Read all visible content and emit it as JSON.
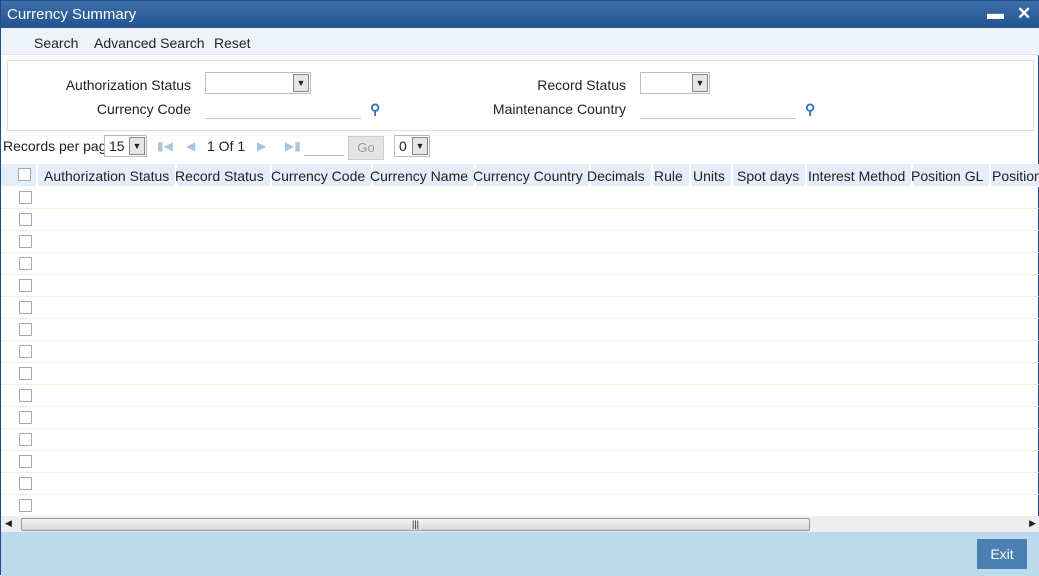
{
  "window": {
    "title": "Currency Summary",
    "minimize": "▬",
    "close": "✕"
  },
  "toolbar": {
    "search": "Search",
    "advanced_search": "Advanced Search",
    "reset": "Reset"
  },
  "filters": {
    "authorization_status": {
      "label": "Authorization Status",
      "value": ""
    },
    "record_status": {
      "label": "Record Status",
      "value": ""
    },
    "currency_code": {
      "label": "Currency Code",
      "value": ""
    },
    "maintenance_country": {
      "label": "Maintenance Country",
      "value": ""
    }
  },
  "pager": {
    "records_per_page_label": "Records per page",
    "records_per_page": "15",
    "page_text": "1 Of 1",
    "go": "Go",
    "goto_page": "0"
  },
  "table": {
    "columns": [
      "Authorization Status",
      "Record Status",
      "Currency Code",
      "Currency Name",
      "Currency Country",
      "Decimals",
      "Rule",
      "Units",
      "Spot days",
      "Interest Method",
      "Position GL",
      "Position"
    ],
    "row_count": 15
  },
  "footer": {
    "exit": "Exit"
  }
}
